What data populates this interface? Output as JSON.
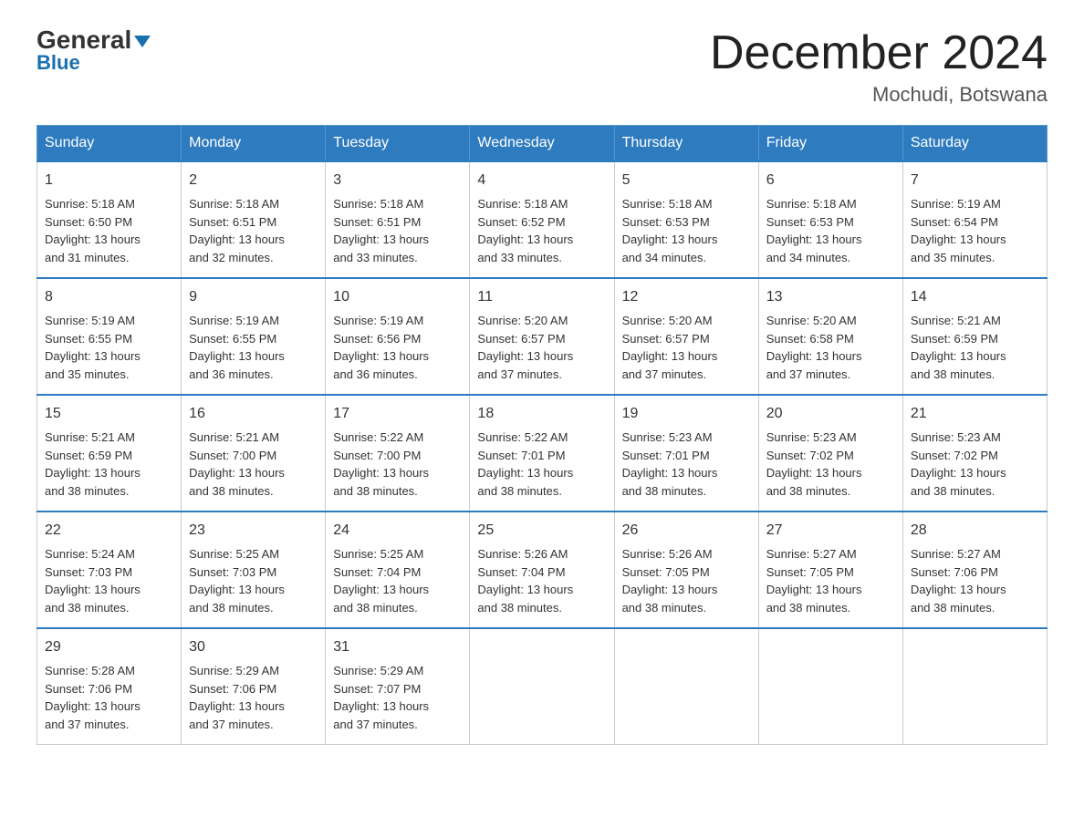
{
  "logo": {
    "general": "General",
    "blue": "Blue"
  },
  "title": "December 2024",
  "location": "Mochudi, Botswana",
  "days_of_week": [
    "Sunday",
    "Monday",
    "Tuesday",
    "Wednesday",
    "Thursday",
    "Friday",
    "Saturday"
  ],
  "weeks": [
    [
      {
        "day": "1",
        "sunrise": "5:18 AM",
        "sunset": "6:50 PM",
        "daylight": "13 hours and 31 minutes."
      },
      {
        "day": "2",
        "sunrise": "5:18 AM",
        "sunset": "6:51 PM",
        "daylight": "13 hours and 32 minutes."
      },
      {
        "day": "3",
        "sunrise": "5:18 AM",
        "sunset": "6:51 PM",
        "daylight": "13 hours and 33 minutes."
      },
      {
        "day": "4",
        "sunrise": "5:18 AM",
        "sunset": "6:52 PM",
        "daylight": "13 hours and 33 minutes."
      },
      {
        "day": "5",
        "sunrise": "5:18 AM",
        "sunset": "6:53 PM",
        "daylight": "13 hours and 34 minutes."
      },
      {
        "day": "6",
        "sunrise": "5:18 AM",
        "sunset": "6:53 PM",
        "daylight": "13 hours and 34 minutes."
      },
      {
        "day": "7",
        "sunrise": "5:19 AM",
        "sunset": "6:54 PM",
        "daylight": "13 hours and 35 minutes."
      }
    ],
    [
      {
        "day": "8",
        "sunrise": "5:19 AM",
        "sunset": "6:55 PM",
        "daylight": "13 hours and 35 minutes."
      },
      {
        "day": "9",
        "sunrise": "5:19 AM",
        "sunset": "6:55 PM",
        "daylight": "13 hours and 36 minutes."
      },
      {
        "day": "10",
        "sunrise": "5:19 AM",
        "sunset": "6:56 PM",
        "daylight": "13 hours and 36 minutes."
      },
      {
        "day": "11",
        "sunrise": "5:20 AM",
        "sunset": "6:57 PM",
        "daylight": "13 hours and 37 minutes."
      },
      {
        "day": "12",
        "sunrise": "5:20 AM",
        "sunset": "6:57 PM",
        "daylight": "13 hours and 37 minutes."
      },
      {
        "day": "13",
        "sunrise": "5:20 AM",
        "sunset": "6:58 PM",
        "daylight": "13 hours and 37 minutes."
      },
      {
        "day": "14",
        "sunrise": "5:21 AM",
        "sunset": "6:59 PM",
        "daylight": "13 hours and 38 minutes."
      }
    ],
    [
      {
        "day": "15",
        "sunrise": "5:21 AM",
        "sunset": "6:59 PM",
        "daylight": "13 hours and 38 minutes."
      },
      {
        "day": "16",
        "sunrise": "5:21 AM",
        "sunset": "7:00 PM",
        "daylight": "13 hours and 38 minutes."
      },
      {
        "day": "17",
        "sunrise": "5:22 AM",
        "sunset": "7:00 PM",
        "daylight": "13 hours and 38 minutes."
      },
      {
        "day": "18",
        "sunrise": "5:22 AM",
        "sunset": "7:01 PM",
        "daylight": "13 hours and 38 minutes."
      },
      {
        "day": "19",
        "sunrise": "5:23 AM",
        "sunset": "7:01 PM",
        "daylight": "13 hours and 38 minutes."
      },
      {
        "day": "20",
        "sunrise": "5:23 AM",
        "sunset": "7:02 PM",
        "daylight": "13 hours and 38 minutes."
      },
      {
        "day": "21",
        "sunrise": "5:23 AM",
        "sunset": "7:02 PM",
        "daylight": "13 hours and 38 minutes."
      }
    ],
    [
      {
        "day": "22",
        "sunrise": "5:24 AM",
        "sunset": "7:03 PM",
        "daylight": "13 hours and 38 minutes."
      },
      {
        "day": "23",
        "sunrise": "5:25 AM",
        "sunset": "7:03 PM",
        "daylight": "13 hours and 38 minutes."
      },
      {
        "day": "24",
        "sunrise": "5:25 AM",
        "sunset": "7:04 PM",
        "daylight": "13 hours and 38 minutes."
      },
      {
        "day": "25",
        "sunrise": "5:26 AM",
        "sunset": "7:04 PM",
        "daylight": "13 hours and 38 minutes."
      },
      {
        "day": "26",
        "sunrise": "5:26 AM",
        "sunset": "7:05 PM",
        "daylight": "13 hours and 38 minutes."
      },
      {
        "day": "27",
        "sunrise": "5:27 AM",
        "sunset": "7:05 PM",
        "daylight": "13 hours and 38 minutes."
      },
      {
        "day": "28",
        "sunrise": "5:27 AM",
        "sunset": "7:06 PM",
        "daylight": "13 hours and 38 minutes."
      }
    ],
    [
      {
        "day": "29",
        "sunrise": "5:28 AM",
        "sunset": "7:06 PM",
        "daylight": "13 hours and 37 minutes."
      },
      {
        "day": "30",
        "sunrise": "5:29 AM",
        "sunset": "7:06 PM",
        "daylight": "13 hours and 37 minutes."
      },
      {
        "day": "31",
        "sunrise": "5:29 AM",
        "sunset": "7:07 PM",
        "daylight": "13 hours and 37 minutes."
      },
      null,
      null,
      null,
      null
    ]
  ],
  "labels": {
    "sunrise": "Sunrise:",
    "sunset": "Sunset:",
    "daylight": "Daylight:"
  }
}
